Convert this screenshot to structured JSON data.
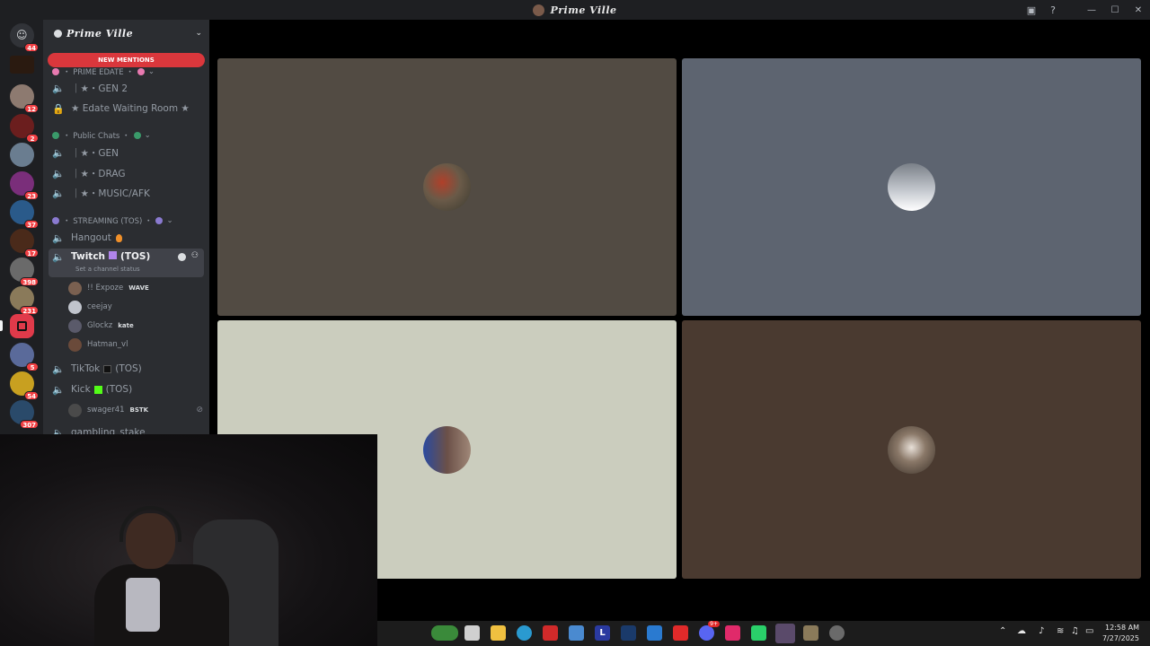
{
  "window": {
    "title": "Prime Ville"
  },
  "guilds": [
    {
      "badge": "44"
    },
    {
      "badge": ""
    },
    {
      "badge": "12"
    },
    {
      "badge": "2"
    },
    {
      "badge": ""
    },
    {
      "badge": "23"
    },
    {
      "badge": "37"
    },
    {
      "badge": "17"
    },
    {
      "badge": "398"
    },
    {
      "badge": "231"
    },
    {
      "badge": ""
    },
    {
      "badge": "5"
    },
    {
      "badge": "54"
    },
    {
      "badge": "307"
    }
  ],
  "server": {
    "name": "Prime Ville",
    "new_mentions": "NEW MENTIONS"
  },
  "categories": {
    "prime_edate": "・ PRIME EDATE ・",
    "public_chats": "・ Public Chats ・",
    "streaming": "・ STREAMING (TOS) ・"
  },
  "channels": {
    "gen2": "｜★・GEN 2",
    "edate_waiting": "★ Edate Waiting Room ★",
    "gen": "｜★・GEN",
    "drag": "｜★・DRAG",
    "music": "｜★・MUSIC/AFK",
    "hangout": "Hangout",
    "twitch_a": "Twitch",
    "twitch_b": "(TOS)",
    "twitch_status": "Set a channel status",
    "tiktok_a": "TikTok",
    "tiktok_b": "(TOS)",
    "kick_a": "Kick",
    "kick_b": "(TOS)",
    "gambling": "gambling_stake"
  },
  "members_twitch": [
    {
      "name": "!! Expoze",
      "tag": "WAVE"
    },
    {
      "name": "ceejay",
      "tag": ""
    },
    {
      "name": "Glockz",
      "tag": "kate"
    },
    {
      "name": "Hatman_vl",
      "tag": ""
    }
  ],
  "members_kick": [
    {
      "name": "swager41",
      "tag": "BSTK"
    }
  ],
  "tiles": [
    {
      "color": "#524b43",
      "avatar_color": "#6a5a48"
    },
    {
      "color": "#5d6470",
      "avatar_color": "#d8dadf"
    },
    {
      "color": "#cbcdbe",
      "avatar_color": "#6b5048"
    },
    {
      "color": "#4a3a30",
      "avatar_color": "#8a7868"
    }
  ],
  "taskbar": {
    "time": "12:58 AM",
    "date": "7/27/2025",
    "badge": "9+"
  },
  "colors": {
    "accent_red": "#da373c",
    "twitch_purple": "#b084ec",
    "kick_green": "#53fc18"
  }
}
